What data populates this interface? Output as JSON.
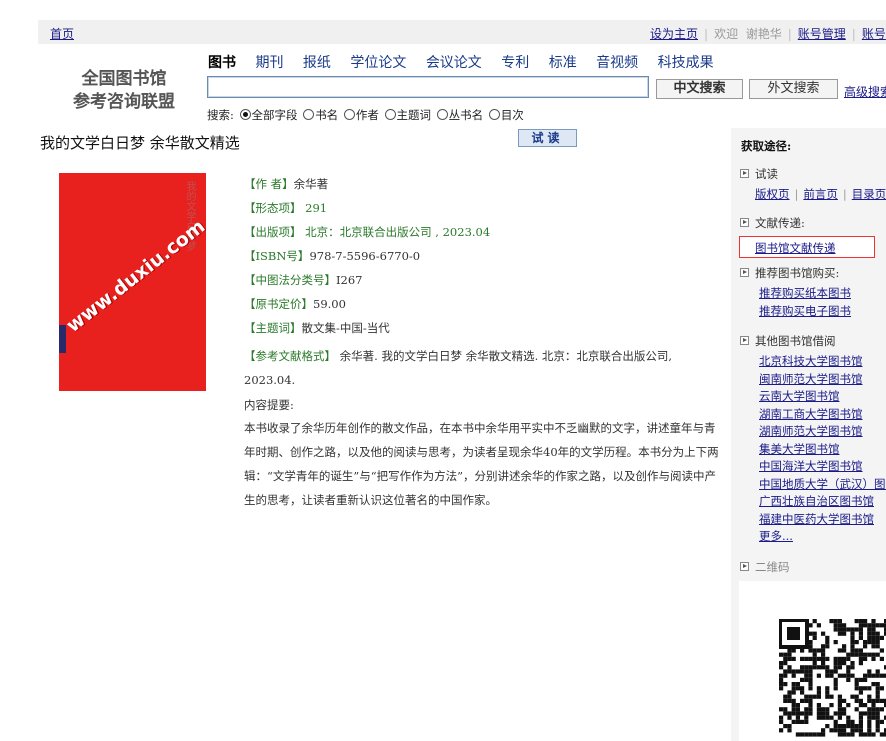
{
  "topbar": {
    "home": "首页",
    "set_home": "设为主页",
    "welcome": "欢迎",
    "user": "谢艳华",
    "account": "账号管理",
    "account2": "账号"
  },
  "logo": {
    "line1": "全国图书馆",
    "line2": "参考咨询联盟"
  },
  "categories": [
    "图书",
    "期刊",
    "报纸",
    "学位论文",
    "会议论文",
    "专利",
    "标准",
    "音视频",
    "科技成果"
  ],
  "search": {
    "value": "",
    "btn_cn_search": "中文搜索",
    "btn_cn_search2": "外文搜索",
    "advanced": "高级搜索",
    "options_label": "搜索:",
    "options": [
      "全部字段",
      "书名",
      "作者",
      "主题词",
      "丛书名",
      "目次"
    ]
  },
  "book": {
    "title": "我的文学白日梦  余华散文精选",
    "try_read": "试读",
    "cover_spine": "我的文学白日梦",
    "cover_watermark": "www.duxiu.com",
    "meta": [
      {
        "key": "【作    者】",
        "val": "余华著"
      },
      {
        "key": "【形态项】",
        "val": " 291"
      },
      {
        "key": "【出版项】",
        "val": " 北京：北京联合出版公司 , 2023.04"
      },
      {
        "key": "【ISBN号】",
        "val": "978-7-5596-6770-0"
      },
      {
        "key": "【中图法分类号】",
        "val": "I267"
      },
      {
        "key": "【原书定价】",
        "val": "59.00"
      },
      {
        "key": "【主题词】",
        "val": "散文集-中国-当代"
      }
    ],
    "citation_key": "【参考文献格式】",
    "citation": " 余华著. 我的文学白日梦  余华散文精选. 北京：北京联合出版公司, 2023.04.",
    "summary_label": "内容提要:",
    "summary": "本书收录了余华历年创作的散文作品，在本书中余华用平实中不乏幽默的文字，讲述童年与青年时期、创作之路，以及他的阅读与思考，为读者呈现余华40年的文学历程。本书分为上下两辑：“文学青年的诞生”与“把写作作为方法”，分别讲述余华的作家之路，以及创作与阅读中产生的思考，让读者重新认识这位著名的中国作家。"
  },
  "sidebar": {
    "head": "获取途径:",
    "try_read": "试读",
    "try_links": [
      "版权页",
      "前言页",
      "目录页"
    ],
    "doc_delivery": "文献传递:",
    "doc_link": "图书馆文献传递",
    "recommend": "推荐图书馆购买:",
    "recommend_links": [
      "推荐购买纸本图书",
      "推荐购买电子图书"
    ],
    "other_libs": "其他图书馆借阅",
    "libraries": [
      "北京科技大学图书馆",
      "闽南师范大学图书馆",
      "云南大学图书馆",
      "湖南工商大学图书馆",
      "湖南师范大学图书馆",
      "集美大学图书馆",
      "中国海洋大学图书馆",
      "中国地质大学（武汉）图书馆",
      "广西壮族自治区图书馆",
      "福建中医药大学图书馆"
    ],
    "more": "更多...",
    "qr_label": "二维码"
  }
}
